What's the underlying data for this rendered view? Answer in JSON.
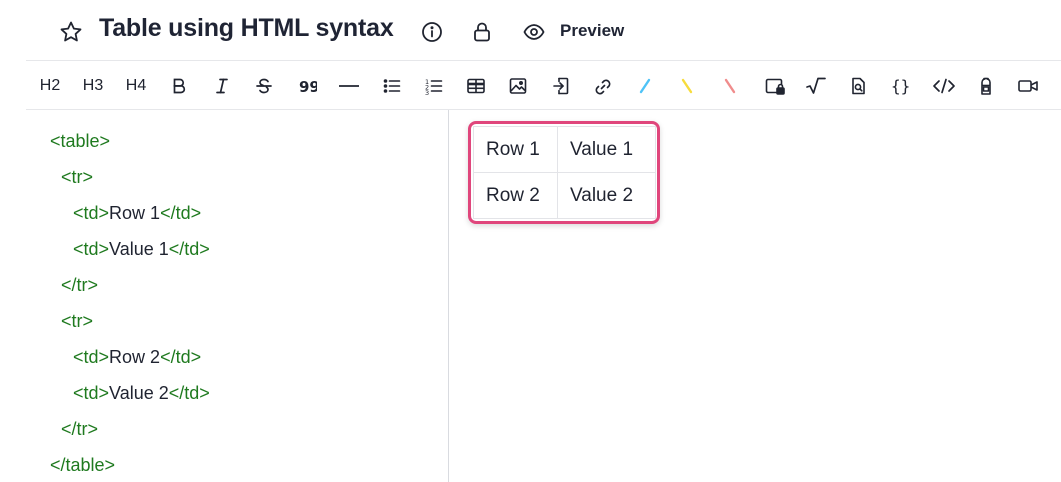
{
  "header": {
    "title": "Table using HTML syntax",
    "preview_label": "Preview"
  },
  "toolbar": {
    "h2": "H2",
    "h3": "H3",
    "h4": "H4",
    "colors": {
      "highlight_blue": "#4fc3f7",
      "highlight_yellow": "#f7dc3c",
      "highlight_red": "#f08c8c"
    }
  },
  "editor": {
    "lines": [
      {
        "indent": "",
        "open": "<table>",
        "text": "",
        "close": ""
      },
      {
        "indent": "  ",
        "open": "<tr>",
        "text": "",
        "close": ""
      },
      {
        "indent": "    ",
        "open": "<td>",
        "text": "Row 1",
        "close": "</td>"
      },
      {
        "indent": "    ",
        "open": "<td>",
        "text": "Value 1",
        "close": "</td>"
      },
      {
        "indent": "  ",
        "open": "</tr>",
        "text": "",
        "close": ""
      },
      {
        "indent": "  ",
        "open": "<tr>",
        "text": "",
        "close": ""
      },
      {
        "indent": "    ",
        "open": "<td>",
        "text": "Row 2",
        "close": "</td>"
      },
      {
        "indent": "    ",
        "open": "<td>",
        "text": "Value 2",
        "close": "</td>"
      },
      {
        "indent": "  ",
        "open": "</tr>",
        "text": "",
        "close": ""
      },
      {
        "indent": "",
        "open": "</table>",
        "text": "",
        "close": ""
      }
    ]
  },
  "preview_table": {
    "rows": [
      [
        "Row 1",
        "Value 1"
      ],
      [
        "Row 2",
        "Value 2"
      ]
    ],
    "highlight_color": "#e0467c"
  }
}
